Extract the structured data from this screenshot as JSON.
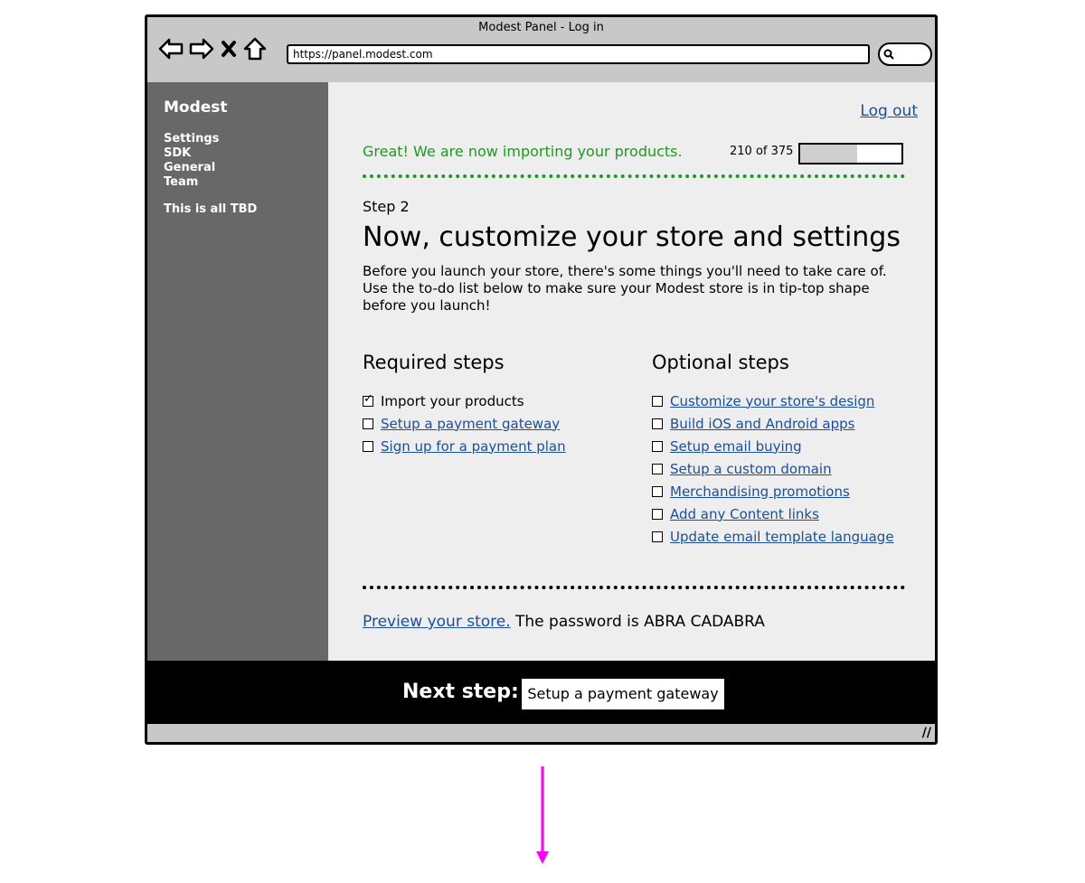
{
  "window": {
    "title": "Modest Panel - Log in",
    "url": "https://panel.modest.com"
  },
  "sidebar": {
    "brand": "Modest",
    "items": [
      "Settings",
      "SDK",
      "General",
      "Team"
    ],
    "note": "This is all TBD"
  },
  "header": {
    "logout": "Log out"
  },
  "import": {
    "message": "Great! We are now importing your products.",
    "count": "210 of 375",
    "progress": 0.56
  },
  "step": {
    "label": "Step 2",
    "heading": "Now, customize your store and settings",
    "intro": "Before you launch your store, there's some things you'll need to take care of. Use the to-do list below to make sure your Modest store is in tip-top shape before you launch!"
  },
  "required": {
    "title": "Required steps",
    "items": [
      {
        "label": "Import your products",
        "checked": true
      },
      {
        "label": "Setup a payment gateway",
        "checked": false
      },
      {
        "label": "Sign up for a payment plan",
        "checked": false
      }
    ]
  },
  "optional": {
    "title": "Optional steps",
    "items": [
      {
        "label": "Customize your store's design",
        "checked": false
      },
      {
        "label": "Build iOS and Android apps",
        "checked": false
      },
      {
        "label": "Setup email buying",
        "checked": false
      },
      {
        "label": "Setup a custom domain",
        "checked": false
      },
      {
        "label": "Merchandising promotions",
        "checked": false
      },
      {
        "label": "Add any Content links",
        "checked": false
      },
      {
        "label": "Update email template language",
        "checked": false
      }
    ]
  },
  "preview": {
    "link": "Preview your store.",
    "text": "The password is ABRA CADABRA"
  },
  "footer": {
    "next_label": "Next step:",
    "next_button": "Setup a payment gateway"
  },
  "colors": {
    "accent_green": "#1f9a1f",
    "link_blue": "#1a4f9a",
    "sidebar": "#686868",
    "arrow": "#ff00ff"
  }
}
